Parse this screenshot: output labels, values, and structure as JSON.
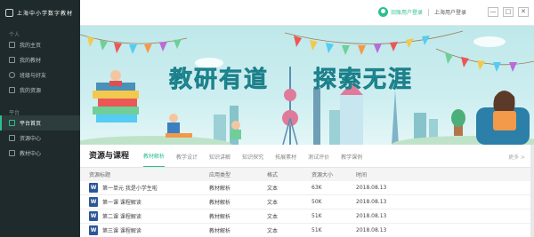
{
  "app": {
    "logo_text": "上海中小学数字教材"
  },
  "sidebar": {
    "sections": [
      {
        "label": "个人"
      },
      {
        "label": "平台"
      }
    ],
    "personal_items": [
      {
        "label": "我的主页",
        "icon": "home-icon"
      },
      {
        "label": "我的教材",
        "icon": "book-icon"
      },
      {
        "label": "班级与好友",
        "icon": "users-icon"
      },
      {
        "label": "我的资源",
        "icon": "folder-icon"
      }
    ],
    "platform_items": [
      {
        "label": "平台首页",
        "icon": "home-icon",
        "active": true
      },
      {
        "label": "资源中心",
        "icon": "grid-icon"
      },
      {
        "label": "教材中心",
        "icon": "book-icon"
      }
    ]
  },
  "topbar": {
    "login_links": [
      "旧账用户登录",
      "上海用户登录"
    ],
    "window_buttons": [
      "—",
      "□",
      "✕"
    ]
  },
  "banner": {
    "title_left": "教研有道",
    "title_right": "探索无涯",
    "colors": {
      "title": "#24a6b3",
      "sky": "#cdeef0"
    }
  },
  "resources": {
    "title": "资源与课程",
    "tabs": [
      "教材解析",
      "教学设计",
      "知识讲解",
      "知识探究",
      "拓展素材",
      "测试评价",
      "教学课例"
    ],
    "active_tab": 0,
    "more_label": "更多 >",
    "columns": [
      "资源标题",
      "应用类型",
      "格式",
      "资源大小",
      "时间"
    ],
    "rows": [
      {
        "title": "第一单元 我是小学生啦",
        "type": "教材解析",
        "format": "文本",
        "size": "63K",
        "time": "2018.08.13"
      },
      {
        "title": "第一课 课程解读",
        "type": "教材解析",
        "format": "文本",
        "size": "50K",
        "time": "2018.08.13"
      },
      {
        "title": "第二课 课程解读",
        "type": "教材解析",
        "format": "文本",
        "size": "51K",
        "time": "2018.08.13"
      },
      {
        "title": "第三课 课程解读",
        "type": "教材解析",
        "format": "文本",
        "size": "51K",
        "time": "2018.08.13"
      }
    ],
    "file_icon": "word-icon",
    "accent": "#2dbf8c"
  }
}
